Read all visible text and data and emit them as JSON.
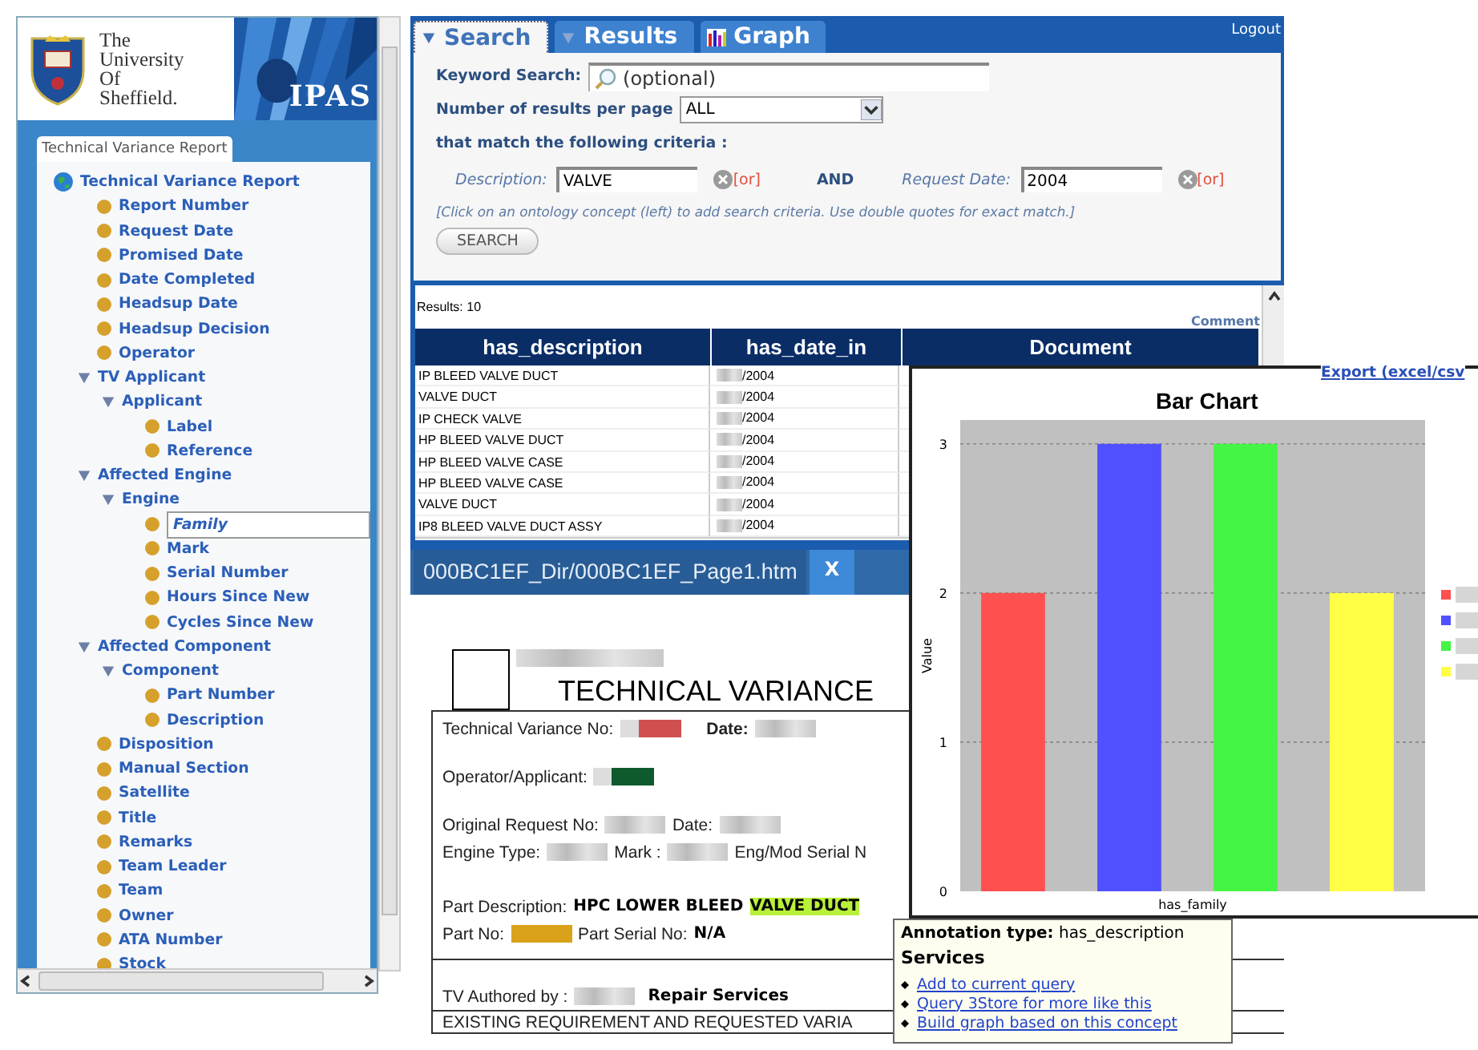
{
  "sidebar": {
    "logo_text": "The University Of Sheffield.",
    "banner_text": "IPAS",
    "tab": "Technical Variance Report",
    "tree": [
      {
        "label": "Technical Variance Report",
        "kind": "root",
        "selected": false,
        "children": [
          {
            "label": "Report Number",
            "kind": "leaf",
            "selected": false
          },
          {
            "label": "Request Date",
            "kind": "leaf",
            "selected": false
          },
          {
            "label": "Promised Date",
            "kind": "leaf",
            "selected": false
          },
          {
            "label": "Date Completed",
            "kind": "leaf",
            "selected": false
          },
          {
            "label": "Headsup Date",
            "kind": "leaf",
            "selected": false
          },
          {
            "label": "Headsup Decision",
            "kind": "leaf",
            "selected": false
          },
          {
            "label": "Operator",
            "kind": "leaf",
            "selected": false
          },
          {
            "label": "TV Applicant",
            "kind": "group",
            "selected": false,
            "expanded": true,
            "children": [
              {
                "label": "Applicant",
                "kind": "group",
                "selected": false,
                "expanded": true,
                "children": [
                  {
                    "label": "Label",
                    "kind": "leaf",
                    "selected": false
                  },
                  {
                    "label": "Reference",
                    "kind": "leaf",
                    "selected": false
                  }
                ]
              }
            ]
          },
          {
            "label": "Affected Engine",
            "kind": "group",
            "selected": false,
            "expanded": true,
            "children": [
              {
                "label": "Engine",
                "kind": "group",
                "selected": false,
                "expanded": true,
                "children": [
                  {
                    "label": "Family",
                    "kind": "leaf",
                    "selected": true
                  },
                  {
                    "label": "Mark",
                    "kind": "leaf",
                    "selected": false
                  },
                  {
                    "label": "Serial Number",
                    "kind": "leaf",
                    "selected": false
                  },
                  {
                    "label": "Hours Since New",
                    "kind": "leaf",
                    "selected": false
                  },
                  {
                    "label": "Cycles Since New",
                    "kind": "leaf",
                    "selected": false
                  }
                ]
              }
            ]
          },
          {
            "label": "Affected Component",
            "kind": "group",
            "selected": false,
            "expanded": true,
            "children": [
              {
                "label": "Component",
                "kind": "group",
                "selected": false,
                "expanded": true,
                "children": [
                  {
                    "label": "Part Number",
                    "kind": "leaf",
                    "selected": false
                  },
                  {
                    "label": "Description",
                    "kind": "leaf",
                    "selected": false
                  }
                ]
              }
            ]
          },
          {
            "label": "Disposition",
            "kind": "leaf",
            "selected": false
          },
          {
            "label": "Manual Section",
            "kind": "leaf",
            "selected": false
          },
          {
            "label": "Satellite",
            "kind": "leaf",
            "selected": false
          },
          {
            "label": "Title",
            "kind": "leaf",
            "selected": false
          },
          {
            "label": "Remarks",
            "kind": "leaf",
            "selected": false
          },
          {
            "label": "Team Leader",
            "kind": "leaf",
            "selected": false
          },
          {
            "label": "Team",
            "kind": "leaf",
            "selected": false
          },
          {
            "label": "Owner",
            "kind": "leaf",
            "selected": false
          },
          {
            "label": "ATA Number",
            "kind": "leaf",
            "selected": false
          },
          {
            "label": "Stock",
            "kind": "leaf",
            "selected": false
          }
        ]
      }
    ]
  },
  "tabs": [
    {
      "label": "Search",
      "kind": "search",
      "selected": true
    },
    {
      "label": "Results",
      "kind": "results",
      "selected": false
    },
    {
      "label": "Graph",
      "kind": "graph",
      "selected": false
    }
  ],
  "logout": "Logout",
  "search": {
    "keyword_label": "Keyword Search:",
    "keyword_placeholder": "(optional)",
    "per_page_label": "Number of results per page",
    "per_page_value": "ALL",
    "criteria_label": "that match the following criteria :",
    "criteria": [
      {
        "label": "Description:",
        "value": "VALVE",
        "or": "[or]"
      },
      {
        "label": "Request Date:",
        "value": "2004",
        "or": "[or]"
      }
    ],
    "joiner": "AND",
    "hint": "[Click on an ontology concept (left) to add search criteria. Use double quotes for exact match.]",
    "button": "SEARCH"
  },
  "results": {
    "count": "Results: 10",
    "comment": "Comment",
    "columns": [
      "has_description",
      "has_date_in",
      "Document"
    ],
    "rows": [
      {
        "description": "IP BLEED VALVE DUCT",
        "date": "/2004"
      },
      {
        "description": "VALVE DUCT",
        "date": "/2004"
      },
      {
        "description": "IP CHECK VALVE",
        "date": "/2004"
      },
      {
        "description": "HP BLEED VALVE DUCT",
        "date": "/2004"
      },
      {
        "description": "HP BLEED VALVE CASE",
        "date": "/2004"
      },
      {
        "description": "HP BLEED VALVE CASE",
        "date": "/2004"
      },
      {
        "description": "VALVE DUCT",
        "date": "/2004"
      },
      {
        "description": "IP8 BLEED VALVE DUCT ASSY",
        "date": "/2004"
      }
    ]
  },
  "document": {
    "tab": "000BC1EF_Dir/000BC1EF_Page1.htm",
    "close": "X",
    "title": "TECHNICAL VARIANCE",
    "lines": [
      [
        {
          "label": "Technical Variance No:",
          "redacted": true,
          "color": "#d05050"
        },
        {
          "label": "Date:",
          "bold": true,
          "redacted": true
        }
      ],
      [
        {
          "label": "Operator/Applicant:",
          "redacted": true,
          "color": "#0e5a2c"
        }
      ],
      [
        {
          "label": "Original Request No:",
          "redacted": true
        },
        {
          "label": "Date:",
          "redacted": true
        }
      ],
      [
        {
          "label": "Engine Type:",
          "redacted": true
        },
        {
          "label": "Mark :",
          "redacted": true
        },
        {
          "label": "Eng/Mod Serial N",
          "redacted": false
        }
      ]
    ],
    "part_description": {
      "label": "Part Description:",
      "value": "HPC LOWER BLEED",
      "highlight": "VALVE DUCT"
    },
    "part_no": {
      "label": "Part No:",
      "color": "#d9a21a",
      "serial_label": "Part Serial No:",
      "serial_value": "N/A"
    },
    "authored": {
      "label": "TV Authored by :",
      "value": "Repair Services"
    },
    "existing": "EXISTING REQUIREMENT AND REQUESTED VARIA"
  },
  "chart_window": {
    "export": "Export (excel/csv",
    "chart_data": {
      "type": "bar",
      "title": "Bar Chart",
      "xlabel": "has_family",
      "ylabel": "Value",
      "ylim": [
        0,
        3.16
      ],
      "grid": true,
      "yticks": [
        0,
        1,
        2,
        3
      ],
      "series": [
        {
          "color": "#ff5050",
          "values": [
            2
          ]
        },
        {
          "color": "#5050ff",
          "values": [
            3
          ]
        },
        {
          "color": "#45f545",
          "values": [
            3
          ]
        },
        {
          "color": "#ffff45",
          "values": [
            2
          ]
        }
      ]
    }
  },
  "tooltip": {
    "label": "Annotation type:",
    "value": "has_description",
    "heading": "Services",
    "links": [
      "Add to current query",
      "Query 3Store for more like this",
      "Build graph based on this concept"
    ]
  }
}
